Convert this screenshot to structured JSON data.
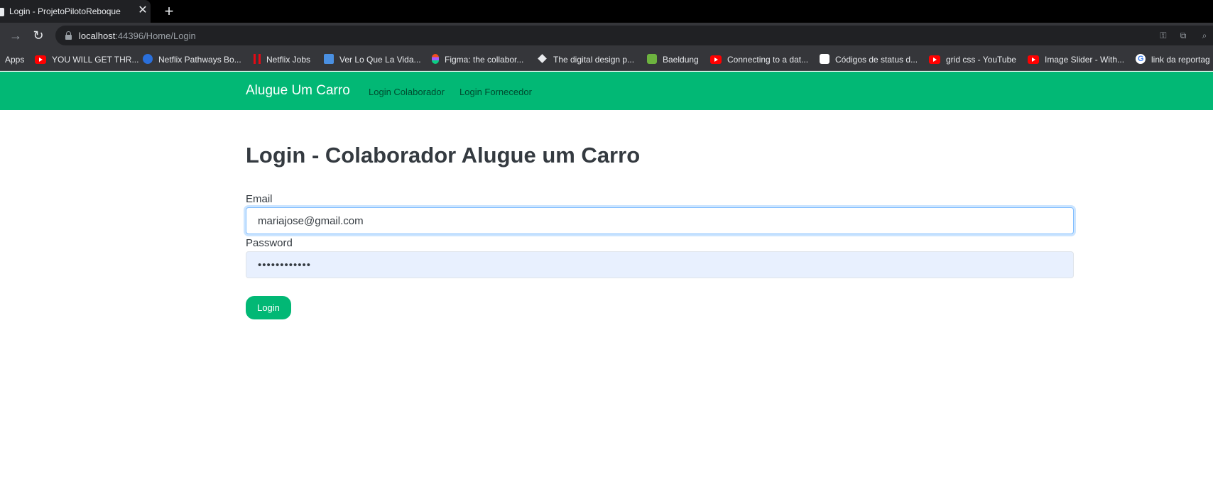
{
  "browser": {
    "tab": {
      "title": "Login - ProjetoPilotoReboque",
      "close": "✕"
    },
    "new_tab": "+",
    "url": {
      "host": "localhost",
      "rest": ":44396/Home/Login"
    },
    "bookmarks": [
      {
        "label": "Apps",
        "icon": "apps-icon"
      },
      {
        "label": "YOU WILL GET THR...",
        "icon": "youtube-icon"
      },
      {
        "label": "Netflix Pathways Bo...",
        "icon": "2u-icon"
      },
      {
        "label": "Netflix Jobs",
        "icon": "netflix-icon"
      },
      {
        "label": "Ver Lo Que La Vida...",
        "icon": "grid-icon"
      },
      {
        "label": "Figma: the collabor...",
        "icon": "figma-icon"
      },
      {
        "label": "The digital design p...",
        "icon": "sketch-icon"
      },
      {
        "label": "Baeldung",
        "icon": "leaf-icon"
      },
      {
        "label": "Connecting to a dat...",
        "icon": "youtube-icon"
      },
      {
        "label": "Códigos de status d...",
        "icon": "mdn-icon"
      },
      {
        "label": "grid css - YouTube",
        "icon": "youtube-icon"
      },
      {
        "label": "Image Slider - With...",
        "icon": "youtube-icon"
      },
      {
        "label": "link da reportag",
        "icon": "google-icon"
      }
    ]
  },
  "navbar": {
    "brand": "Alugue Um Carro",
    "links": [
      "Login Colaborador",
      "Login Fornecedor"
    ],
    "color": "#02b875"
  },
  "main": {
    "title": "Login - Colaborador Alugue um Carro",
    "email_label": "Email",
    "email_value": "mariajose@gmail.com",
    "password_label": "Password",
    "password_value": "••••••••••••",
    "submit_label": "Login"
  }
}
